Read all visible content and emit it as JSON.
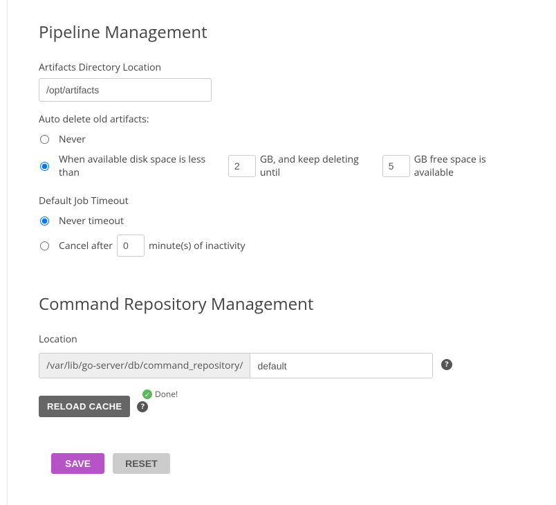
{
  "pipeline": {
    "heading": "Pipeline Management",
    "artifacts_dir_label": "Artifacts Directory Location",
    "artifacts_dir_value": "/opt/artifacts",
    "auto_delete_label": "Auto delete old artifacts:",
    "never_label": "Never",
    "when_prefix": "When available disk space is less than",
    "when_gb1": "GB, and keep deleting until",
    "when_gb2": "GB free space is available",
    "threshold_low": "2",
    "threshold_high": "5",
    "timeout_label": "Default Job Timeout",
    "never_timeout_label": "Never timeout",
    "cancel_after_label": "Cancel after",
    "cancel_after_value": "0",
    "cancel_after_suffix": "minute(s) of inactivity"
  },
  "command_repo": {
    "heading": "Command Repository Management",
    "location_label": "Location",
    "prefix": "/var/lib/go-server/db/command_repository/",
    "value": "default",
    "reload_label": "RELOAD CACHE",
    "done_label": "Done!"
  },
  "actions": {
    "save": "SAVE",
    "reset": "RESET"
  }
}
